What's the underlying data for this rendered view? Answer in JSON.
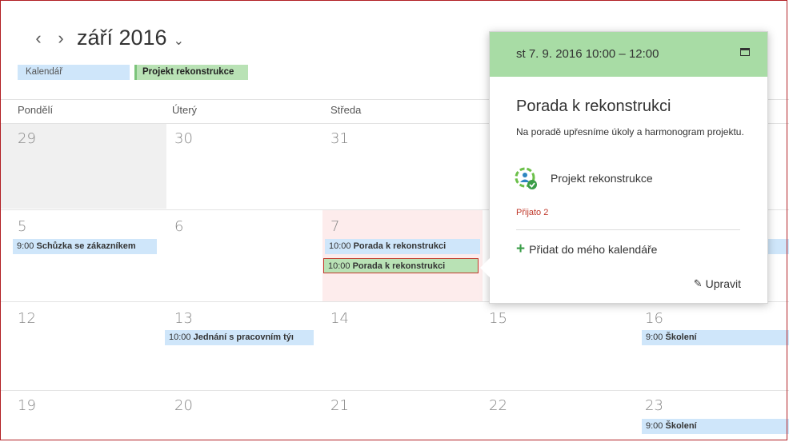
{
  "header": {
    "prev": "‹",
    "next": "›",
    "month": "září 2016",
    "caret": "⌄"
  },
  "calendars": [
    {
      "label": "Kalendář",
      "color": "#cfe6fa"
    },
    {
      "label": "Projekt rekonstrukce",
      "color": "#b9e2b5"
    }
  ],
  "weekdays": [
    "Pondělí",
    "Úterý",
    "Středa"
  ],
  "weeks": [
    {
      "days": [
        "29",
        "30",
        "31"
      ]
    },
    {
      "days": [
        "5",
        "6",
        "7"
      ]
    },
    {
      "days": [
        "12",
        "13",
        "14",
        "15",
        "16"
      ]
    },
    {
      "days": [
        "19",
        "20",
        "21",
        "22",
        "23"
      ]
    }
  ],
  "events": {
    "w2_mon": {
      "time": "9:00",
      "title": "Schůzka se zákazníkem"
    },
    "w2_wed_a": {
      "time": "10:00",
      "title": "Porada k rekonstrukci"
    },
    "w2_wed_b": {
      "time": "10:00",
      "title": "Porada k rekonstrukci"
    },
    "w3_tue": {
      "time": "10:00",
      "title": "Jednání s pracovním týı"
    },
    "w3_fri": {
      "time": "9:00",
      "title": "Školení"
    },
    "w4_fri": {
      "time": "9:00",
      "title": "Školení"
    }
  },
  "popup": {
    "datetime": "st 7. 9. 2016 10:00 – 12:00",
    "title": "Porada k rekonstrukci",
    "description": "Na poradě upřesníme úkoly a harmonogram projektu.",
    "calendar": "Projekt rekonstrukce",
    "status": "Přijato 2",
    "add": "Přidat do mého kalendáře",
    "edit": "Upravit",
    "header_color": "#a8dca5"
  }
}
